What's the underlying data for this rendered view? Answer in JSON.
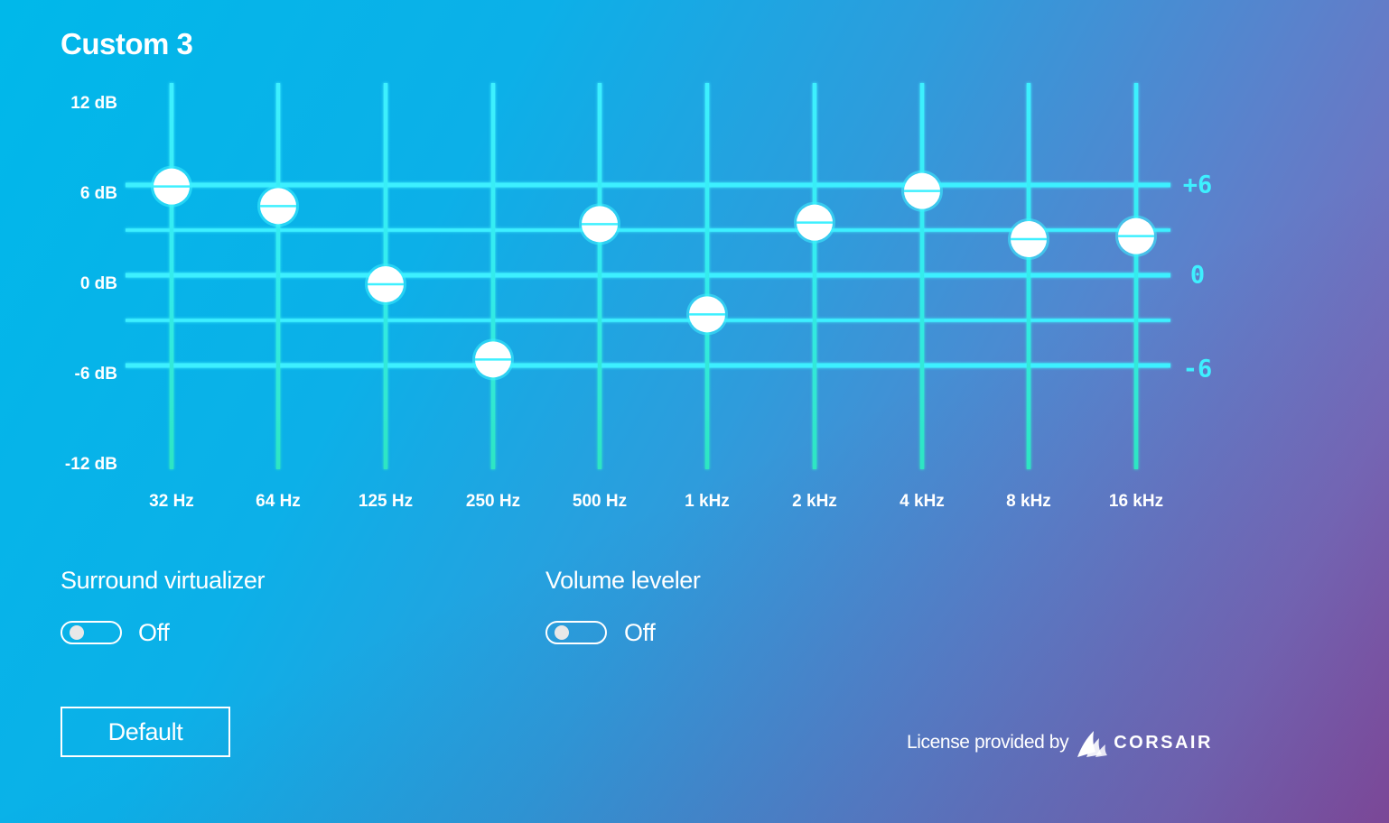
{
  "title": "Custom 3",
  "equalizer": {
    "y_axis": {
      "labels": [
        "12 dB",
        "6 dB",
        "0 dB",
        "-6 dB",
        "-12 dB"
      ],
      "range": [
        -12,
        12
      ]
    },
    "side_labels": [
      "+6",
      "0",
      "-6"
    ],
    "bands": [
      {
        "label": "32 Hz",
        "gain_db": 5.9
      },
      {
        "label": "64 Hz",
        "gain_db": 4.6
      },
      {
        "label": "125 Hz",
        "gain_db": -0.6
      },
      {
        "label": "250 Hz",
        "gain_db": -5.6
      },
      {
        "label": "500 Hz",
        "gain_db": 3.4
      },
      {
        "label": "1 kHz",
        "gain_db": -2.6
      },
      {
        "label": "2 kHz",
        "gain_db": 3.5
      },
      {
        "label": "4 kHz",
        "gain_db": 5.6
      },
      {
        "label": "8 kHz",
        "gain_db": 2.4
      },
      {
        "label": "16 kHz",
        "gain_db": 2.6
      }
    ]
  },
  "surround_virtualizer": {
    "label": "Surround virtualizer",
    "state": "Off"
  },
  "volume_leveler": {
    "label": "Volume leveler",
    "state": "Off"
  },
  "default_button": "Default",
  "license": {
    "text": "License provided by",
    "brand": "CORSAIR",
    "logo_icon": "corsair-sails-logo"
  },
  "colors": {
    "accent": "#3ef0ff",
    "line_bottom": "#2ee6c2",
    "knob": "#ffffff"
  }
}
